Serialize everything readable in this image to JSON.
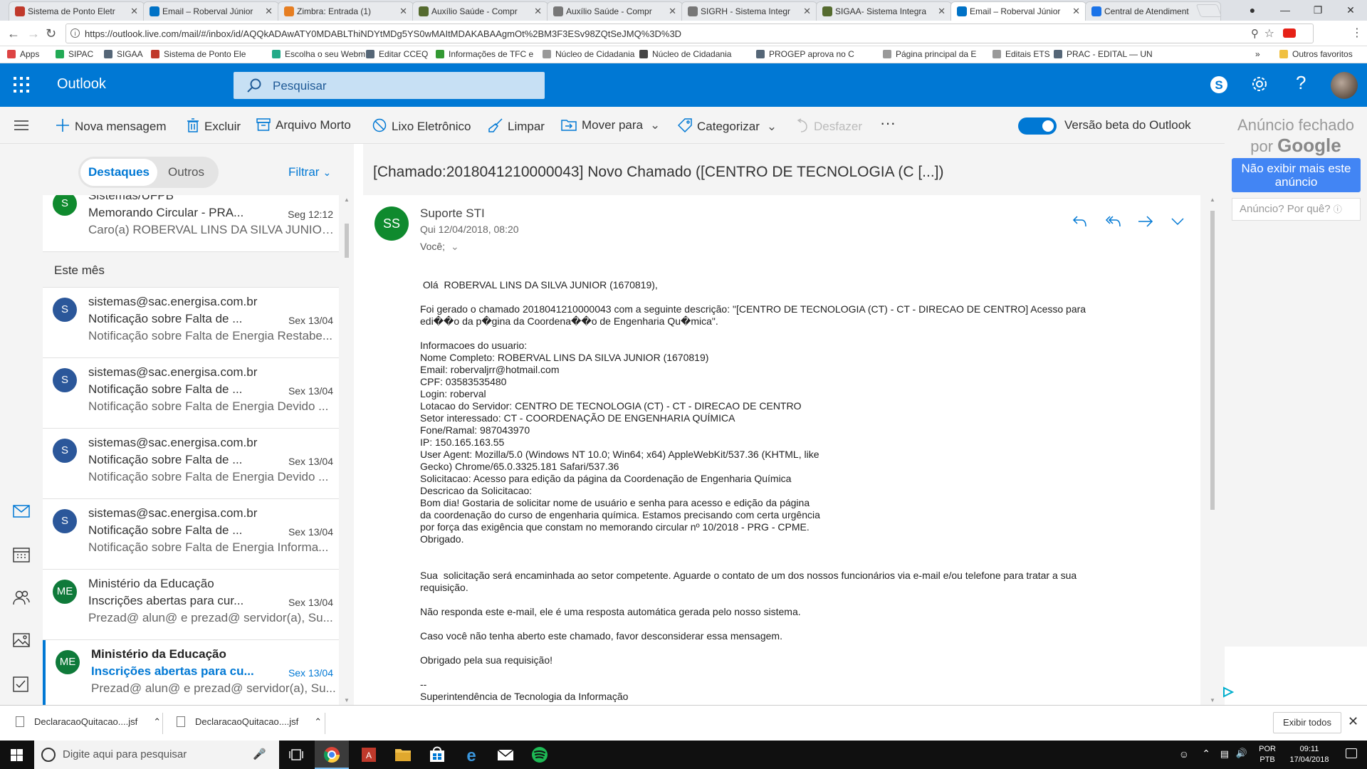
{
  "browser": {
    "tabs": [
      {
        "title": "Sistema de Ponto Eletr",
        "color": "#c0392b"
      },
      {
        "title": "Email – Roberval Júnior",
        "color": "#0072c6"
      },
      {
        "title": "Zimbra: Entrada (1)",
        "color": "#e67e22"
      },
      {
        "title": "Auxílio Saúde - Compr",
        "color": "#556b2f"
      },
      {
        "title": "Auxílio Saúde - Compr",
        "color": "#777777"
      },
      {
        "title": "SIGRH - Sistema Integr",
        "color": "#777777"
      },
      {
        "title": "SIGAA- Sistema Integra",
        "color": "#556b2f"
      },
      {
        "title": "Email – Roberval Júnior",
        "color": "#0072c6"
      },
      {
        "title": "Central de Atendiment",
        "color": "#1a73e8"
      }
    ],
    "active_tab": 7,
    "url": "https://outlook.live.com/mail/#/inbox/id/AQQkADAwATY0MDABLThiNDYtMDg5YS0wMAItMDAKABAAgmOt%2BM3F3ESv98ZQtSeJMQ%3D%3D",
    "bookmarks": [
      {
        "label": "Apps",
        "color": "#d44"
      },
      {
        "label": "SIPAC",
        "color": "#2a5"
      },
      {
        "label": "SIGAA",
        "color": "#567"
      },
      {
        "label": "Sistema de Ponto Ele",
        "color": "#c0392b"
      },
      {
        "label": "Escolha o seu Webm",
        "color": "#2a8"
      },
      {
        "label": "Editar CCEQ",
        "color": "#567"
      },
      {
        "label": "Informações de TFC e",
        "color": "#393"
      },
      {
        "label": "Núcleo de Cidadania",
        "color": "#999"
      },
      {
        "label": "Núcleo de Cidadania",
        "color": "#444"
      },
      {
        "label": "PROGEP aprova no C",
        "color": "#567"
      },
      {
        "label": "Página principal da E",
        "color": "#999"
      },
      {
        "label": "Editais ETS",
        "color": "#999"
      },
      {
        "label": "PRAC - EDITAL — UN",
        "color": "#567"
      }
    ],
    "other_bookmarks": "Outros favoritos"
  },
  "outlook": {
    "brand": "Outlook",
    "search_placeholder": "Pesquisar"
  },
  "commands": {
    "new_message": "Nova mensagem",
    "delete": "Excluir",
    "archive": "Arquivo Morto",
    "junk": "Lixo Eletrônico",
    "sweep": "Limpar",
    "move_to": "Mover para",
    "categorize": "Categorizar",
    "undo": "Desfazer",
    "more": "···",
    "beta_label": "Versão beta do Outlook"
  },
  "list": {
    "focused": "Destaques",
    "other": "Outros",
    "filter": "Filtrar",
    "section_this_month": "Este mês",
    "messages": [
      {
        "initials": "S",
        "color": "#0f8a2e",
        "from": "Sistemas/UFPB",
        "subject": "Memorando Circular - PRA...",
        "date": "Seg 12:12",
        "preview": "Caro(a) ROBERVAL LINS DA SILVA JUNIOR ..."
      },
      {
        "initials": "S",
        "color": "#2b579a",
        "from": "sistemas@sac.energisa.com.br",
        "subject": "Notificação sobre Falta de ...",
        "date": "Sex 13/04",
        "preview": "Notificação sobre Falta de Energia Restabe..."
      },
      {
        "initials": "S",
        "color": "#2b579a",
        "from": "sistemas@sac.energisa.com.br",
        "subject": "Notificação sobre Falta de ...",
        "date": "Sex 13/04",
        "preview": "Notificação sobre Falta de Energia Devido ..."
      },
      {
        "initials": "S",
        "color": "#2b579a",
        "from": "sistemas@sac.energisa.com.br",
        "subject": "Notificação sobre Falta de ...",
        "date": "Sex 13/04",
        "preview": "Notificação sobre Falta de Energia Devido ..."
      },
      {
        "initials": "S",
        "color": "#2b579a",
        "from": "sistemas@sac.energisa.com.br",
        "subject": "Notificação sobre Falta de ...",
        "date": "Sex 13/04",
        "preview": "Notificação sobre Falta de Energia Informa..."
      },
      {
        "initials": "ME",
        "color": "#0f7a3a",
        "from": "Ministério da Educação",
        "subject": "Inscrições abertas para cur...",
        "date": "Sex 13/04",
        "preview": "Prezad@ alun@ e prezad@ servidor(a), Su..."
      },
      {
        "initials": "ME",
        "color": "#0f7a3a",
        "from": "Ministério da Educação",
        "subject": "Inscrições abertas para cu...",
        "date": "Sex 13/04",
        "preview": "Prezad@ alun@ e prezad@ servidor(a), Su..."
      }
    ]
  },
  "reading": {
    "subject": "[Chamado:2018041210000043] Novo Chamado ([CENTRO DE TECNOLOGIA (C [...])",
    "sender_initials": "SS",
    "sender": "Suporte STI",
    "date": "Qui 12/04/2018, 08:20",
    "to": "Você;",
    "body": [
      " Olá  ROBERVAL LINS DA SILVA JUNIOR (1670819),",
      "",
      "Foi gerado o chamado 2018041210000043 com a seguinte descrição: \"[CENTRO DE TECNOLOGIA (CT) - CT - DIRECAO DE CENTRO] Acesso para\nedi��o da p�gina da Coordena��o de Engenharia Qu�mica\".",
      "",
      "Informacoes do usuario:\nNome Completo: ROBERVAL LINS DA SILVA JUNIOR (1670819)\nEmail: robervaljrr@hotmail.com\nCPF: 03583535480\nLogin: roberval\nLotacao do Servidor: CENTRO DE TECNOLOGIA (CT) - CT - DIRECAO DE CENTRO\nSetor interessado: CT - COORDENAÇÃO DE ENGENHARIA QUÍMICA\nFone/Ramal: 987043970\nIP: 150.165.163.55\nUser Agent: Mozilla/5.0 (Windows NT 10.0; Win64; x64) AppleWebKit/537.36 (KHTML, like\nGecko) Chrome/65.0.3325.181 Safari/537.36\nSolicitacao: Acesso para edição da página da Coordenação de Engenharia Química\nDescricao da Solicitacao:\nBom dia! Gostaria de solicitar nome de usuário e senha para acesso e edição da página\nda coordenação do curso de engenharia química. Estamos precisando com certa urgência\npor força das exigência que constam no memorando circular nº 10/2018 - PRG - CPME.\nObrigado.",
      "",
      "",
      "Sua  solicitação será encaminhada ao setor competente. Aguarde o contato de um dos nossos funcionários via e-mail e/ou telefone para tratar a sua\nrequisição.",
      "",
      "Não responda este e-mail, ele é uma resposta automática gerada pelo nosso sistema.",
      "",
      "Caso você não tenha aberto este chamado, favor desconsiderar essa mensagem.",
      "",
      "Obrigado pela sua requisição!",
      "",
      "--\nSuperintendência de Tecnologia da Informação"
    ]
  },
  "ad": {
    "closed_line1": "Anúncio fechado",
    "closed_by": "por",
    "google": "Google",
    "stop_button": "Não exibir mais este anúncio",
    "why": "Anúncio? Por quê?"
  },
  "downloads": {
    "files": [
      "DeclaracaoQuitacao....jsf",
      "DeclaracaoQuitacao....jsf"
    ],
    "show_all": "Exibir todos"
  },
  "taskbar": {
    "search_placeholder": "Digite aqui para pesquisar",
    "lang1": "POR",
    "lang2": "PTB",
    "time": "09:11",
    "date": "17/04/2018"
  }
}
